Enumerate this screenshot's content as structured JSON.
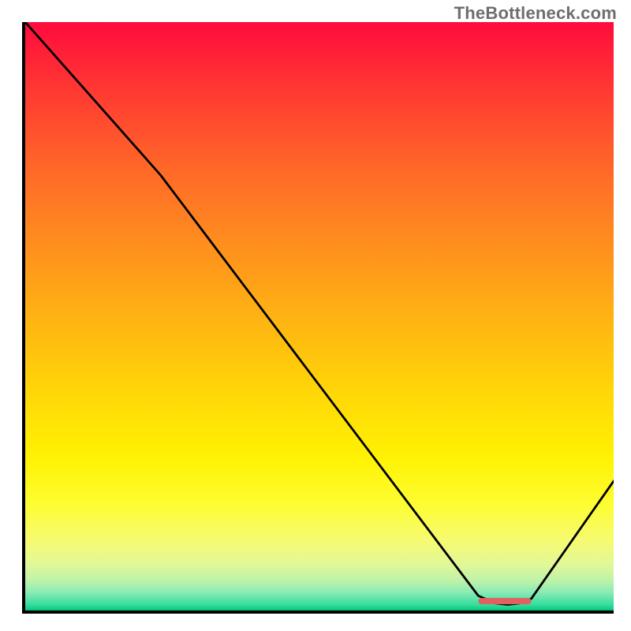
{
  "watermark": {
    "text": "TheBottleneck.com"
  },
  "chart_data": {
    "type": "line",
    "title": "",
    "xlabel": "",
    "ylabel": "",
    "xlim": [
      0,
      100
    ],
    "ylim": [
      0,
      100
    ],
    "series": [
      {
        "name": "bottleneck-curve",
        "x": [
          0,
          23,
          77,
          80,
          82,
          84,
          86,
          100
        ],
        "y": [
          100,
          74,
          2.5,
          1.2,
          1.0,
          1.2,
          2.0,
          22
        ]
      }
    ],
    "marker": {
      "name": "optimal-zone",
      "x_start": 77,
      "x_end": 86,
      "y": 1.6,
      "color": "#e0615f"
    },
    "gradient_stops": [
      {
        "pos": 0,
        "color": "#ff0b3c"
      },
      {
        "pos": 12,
        "color": "#ff3a32"
      },
      {
        "pos": 25,
        "color": "#ff6828"
      },
      {
        "pos": 38,
        "color": "#ff8f1e"
      },
      {
        "pos": 50,
        "color": "#ffb213"
      },
      {
        "pos": 62,
        "color": "#ffd408"
      },
      {
        "pos": 74,
        "color": "#fff203"
      },
      {
        "pos": 82,
        "color": "#fdfd32"
      },
      {
        "pos": 88,
        "color": "#f6fb70"
      },
      {
        "pos": 92,
        "color": "#e3f896"
      },
      {
        "pos": 95,
        "color": "#bdf2aa"
      },
      {
        "pos": 97,
        "color": "#87eab6"
      },
      {
        "pos": 99,
        "color": "#36de9e"
      },
      {
        "pos": 100,
        "color": "#00c878"
      }
    ]
  }
}
